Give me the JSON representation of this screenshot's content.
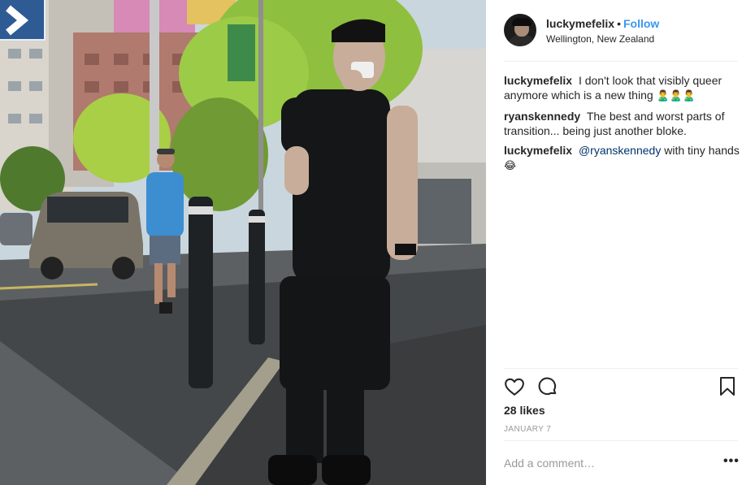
{
  "post": {
    "username": "luckymefelix",
    "separator": "•",
    "follow_label": "Follow",
    "location": "Wellington, New Zealand"
  },
  "comments": [
    {
      "user": "luckymefelix",
      "text": "I don't look that visibly queer anymore which is a new thing",
      "emoji": "🙎‍♂️🙎‍♂️🙎‍♂️"
    },
    {
      "user": "ryanskennedy",
      "text": "The best and worst parts of transition... being just another bloke."
    },
    {
      "user": "luckymefelix",
      "mention": "@ryanskennedy",
      "text": "with tiny hands",
      "emoji": "😂"
    }
  ],
  "stats": {
    "likes": "28 likes",
    "date": "JANUARY 7"
  },
  "comment_box": {
    "placeholder": "Add a comment…",
    "more_label": "•••"
  },
  "icons": [
    "heart-icon",
    "comment-icon",
    "bookmark-icon",
    "next-arrow-icon"
  ],
  "colors": {
    "link": "#3897f0",
    "mention": "#003569",
    "muted": "#999999",
    "divider": "#efefef"
  }
}
